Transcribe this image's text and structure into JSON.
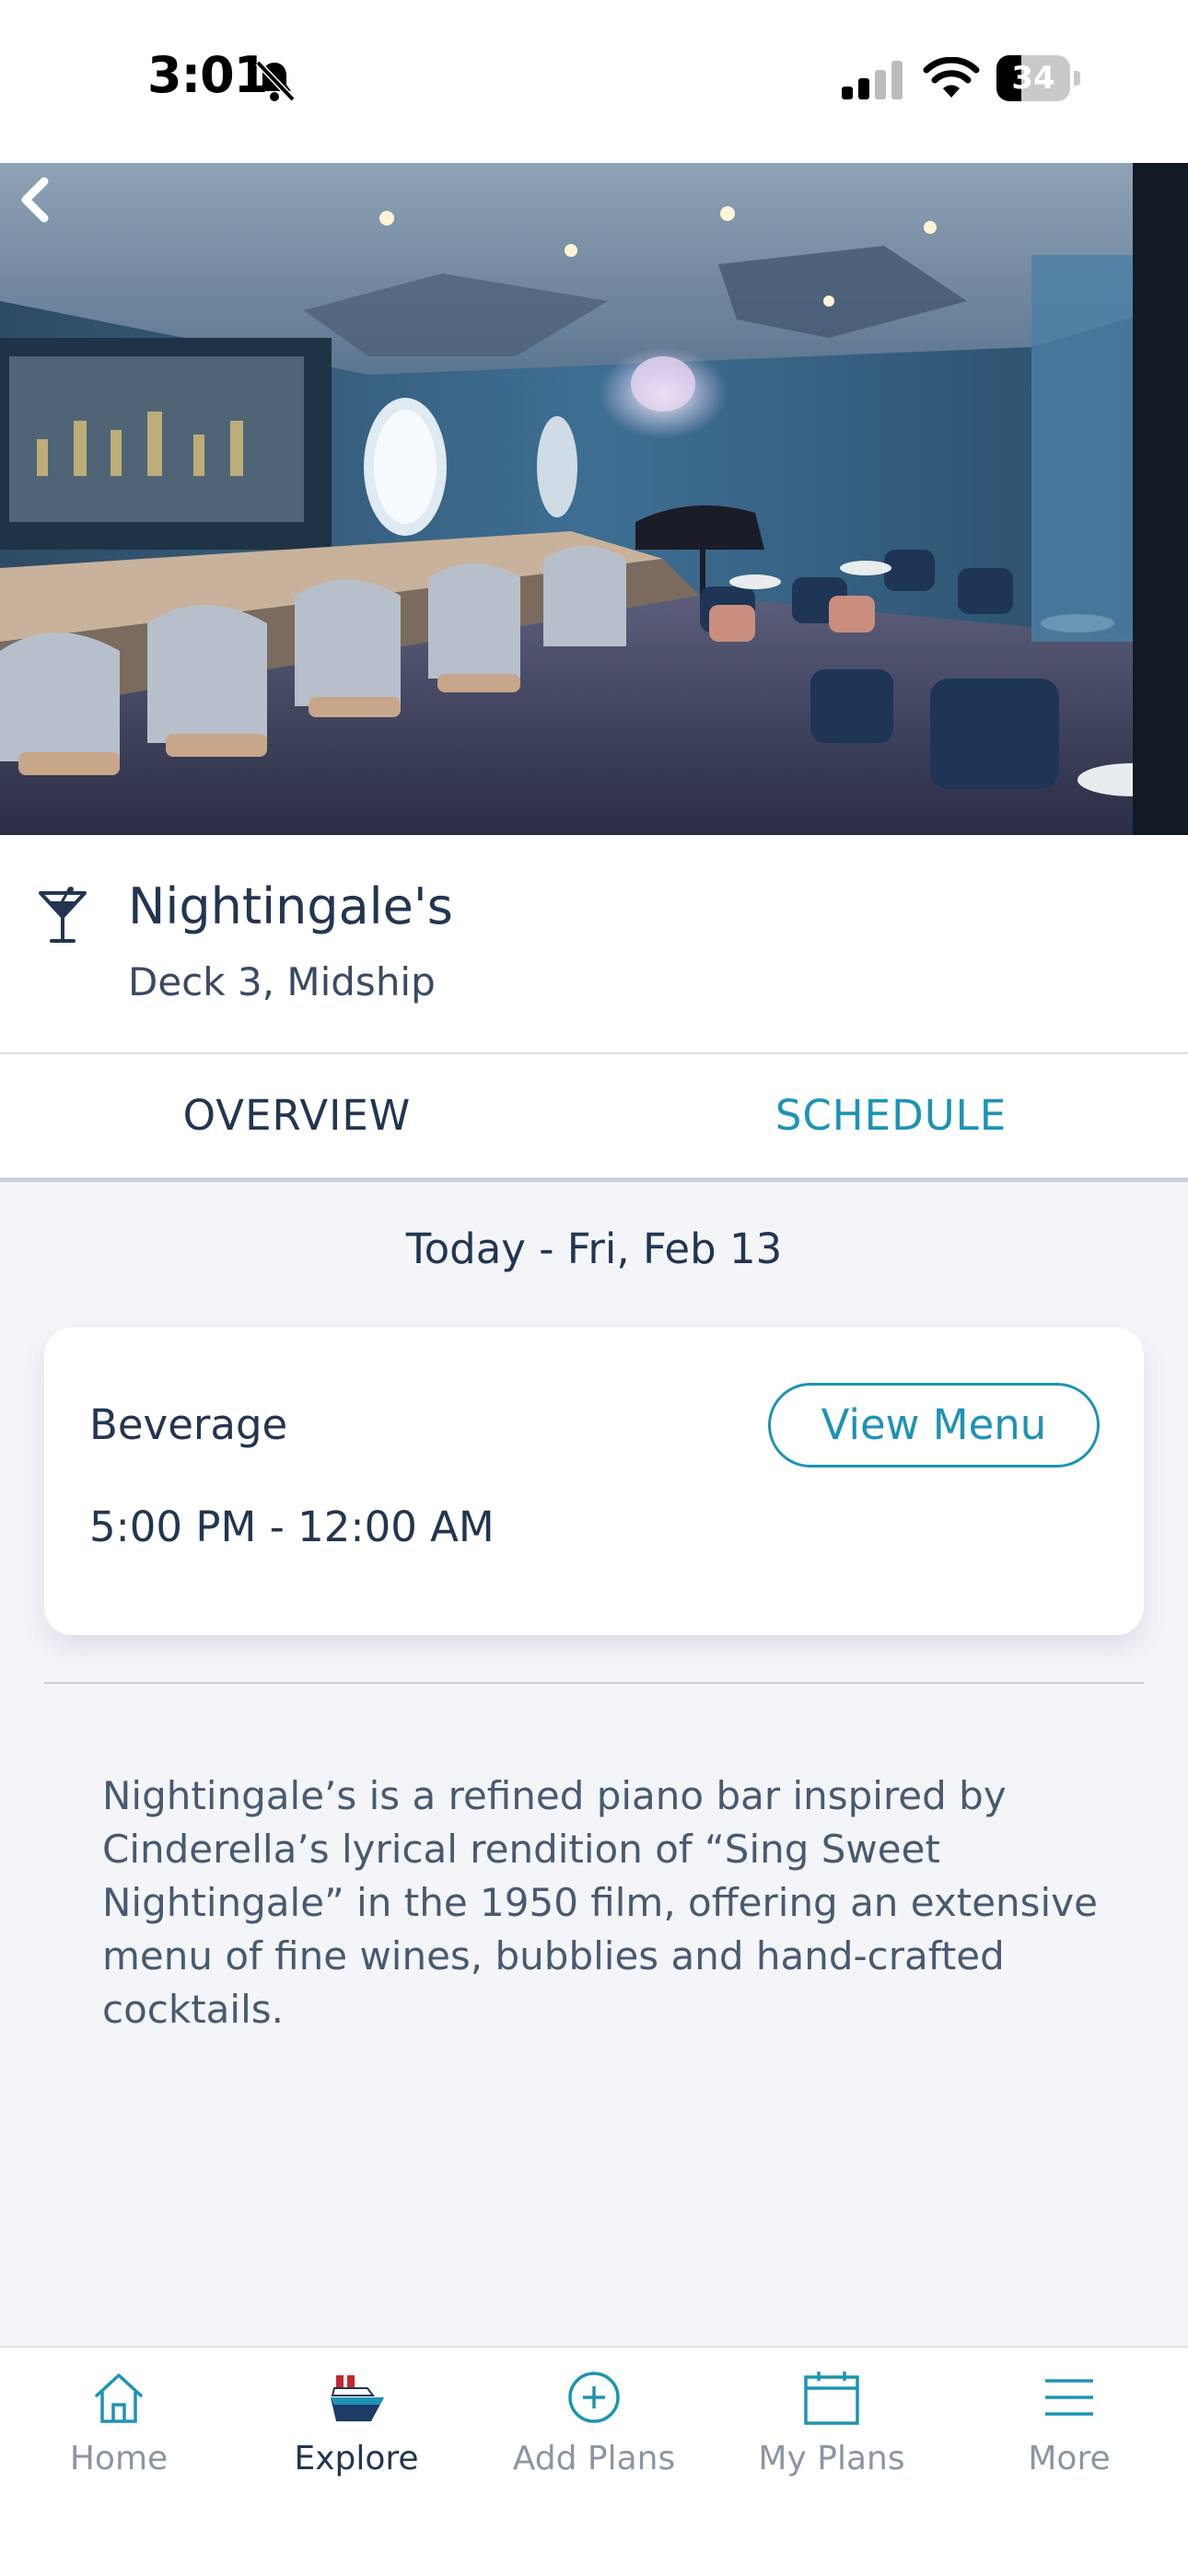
{
  "status_bar": {
    "time": "3:01",
    "battery": "34",
    "battery_level_percent": 34
  },
  "hero": {
    "image": "piano-bar-lounge-photo",
    "back_icon": "chevron-left-icon"
  },
  "venue": {
    "icon": "cocktail-glass-icon",
    "name": "Nightingale's",
    "location": "Deck 3, Midship"
  },
  "tabs": [
    {
      "label": "OVERVIEW",
      "selected": false
    },
    {
      "label": "SCHEDULE",
      "selected": true
    }
  ],
  "schedule": {
    "date_heading": "Today - Fri, Feb 13",
    "card": {
      "title": "Beverage",
      "button_label": "View Menu",
      "hours": "5:00 PM - 12:00 AM"
    }
  },
  "description": "Nightingale’s is a refined piano bar inspired by Cinderella’s lyrical rendition of “Sing Sweet Nightingale” in the 1950 film, offering an extensive menu of fine wines, bubblies and hand-crafted cocktails.",
  "bottom_nav": [
    {
      "label": "Home",
      "icon": "home-icon",
      "active": false
    },
    {
      "label": "Explore",
      "icon": "ship-icon",
      "active": true
    },
    {
      "label": "Add Plans",
      "icon": "plus-circle-icon",
      "active": false
    },
    {
      "label": "My Plans",
      "icon": "calendar-icon",
      "active": false
    },
    {
      "label": "More",
      "icon": "menu-icon",
      "active": false
    }
  ],
  "colors": {
    "accent": "#1e93b4",
    "text_dark": "#233550",
    "background": "#f3f5f9",
    "nav_inactive": "#8b95a3"
  }
}
